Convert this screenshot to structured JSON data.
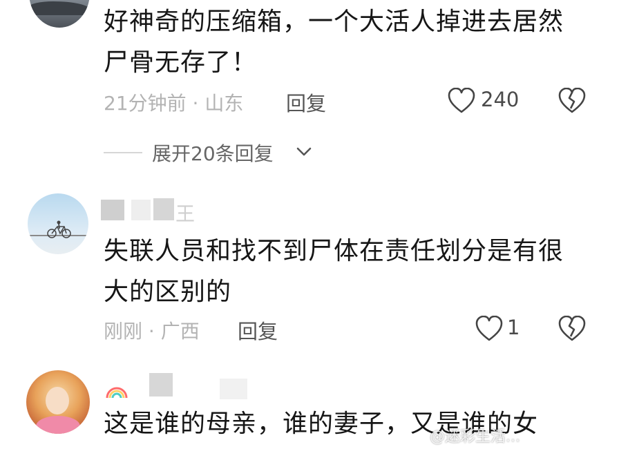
{
  "comments": [
    {
      "content": "好神奇的压缩箱，一个大活人掉进去居然尸骨无存了！",
      "line1": "好神奇的压缩箱，一个大活人掉进去居然",
      "line2": "尸骨无存了！",
      "time_location": "21分钟前 · 山东",
      "reply_label": "回复",
      "likes": "240",
      "expand_replies": "展开20条回复"
    },
    {
      "username_partial": "王",
      "line1": "失联人员和找不到尸体在责任划分是有很",
      "line2": "大的区别的",
      "time_location": "刚刚 · 广西",
      "reply_label": "回复",
      "likes": "1"
    },
    {
      "line1": "这是谁的母亲，谁的妻子，又是谁的女"
    }
  ],
  "watermark": "@迷彩生活...",
  "icons": {
    "like": "heart-outline-icon",
    "dislike": "broken-heart-icon",
    "expand": "chevron-down-icon"
  },
  "colors": {
    "text": "#161616",
    "meta": "#b3b3b3",
    "icon": "#444444"
  }
}
